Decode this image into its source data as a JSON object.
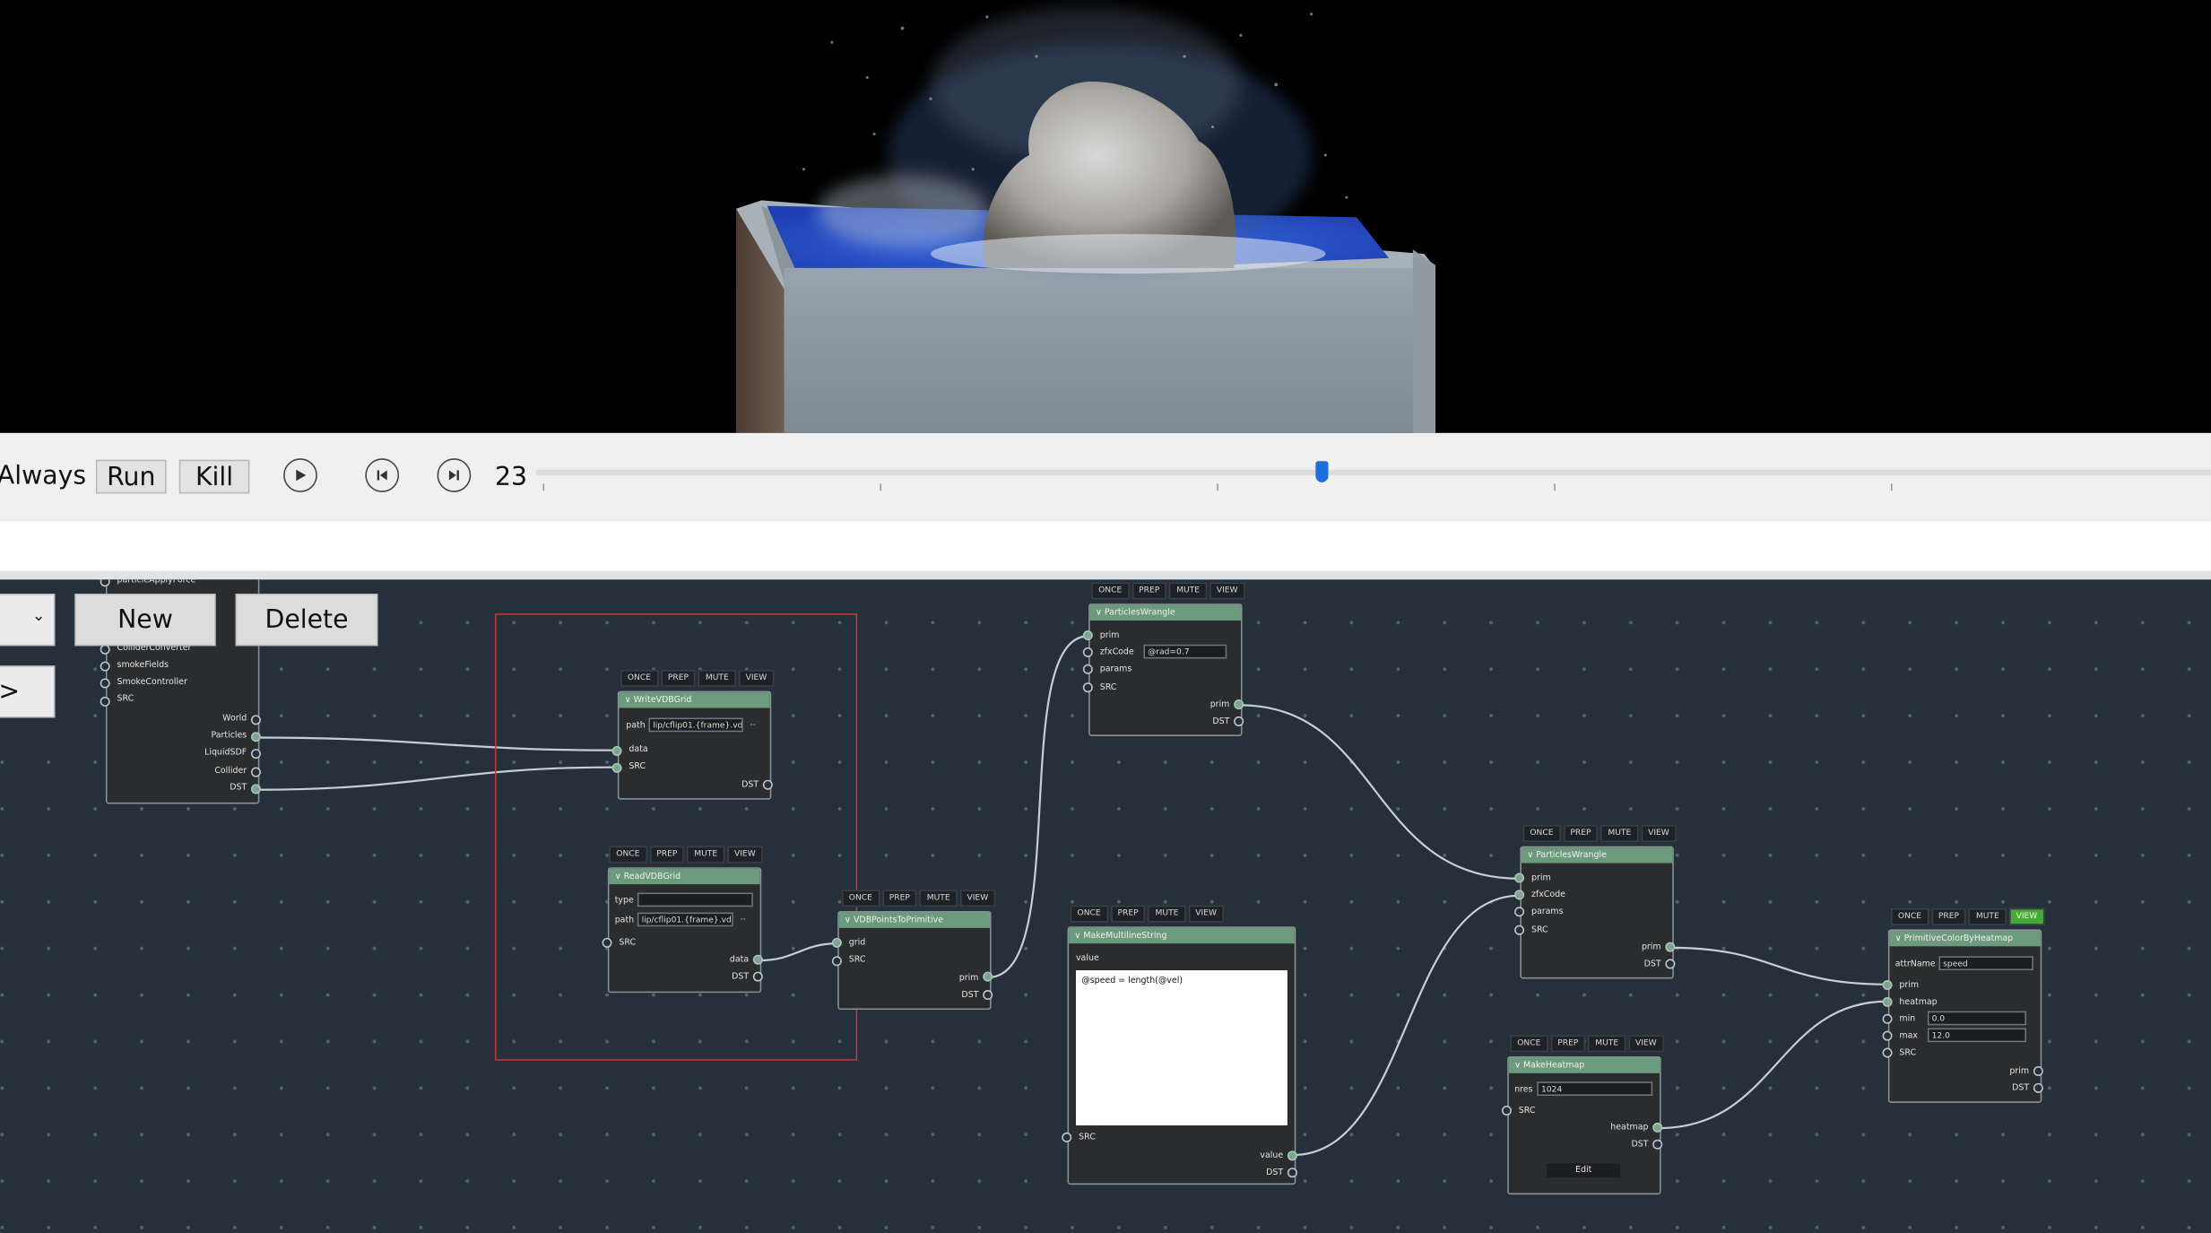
{
  "timeline": {
    "mode_label": "Always",
    "run_label": "Run",
    "kill_label": "Kill",
    "frame": "23",
    "slider_position": 0.48
  },
  "editor_buttons": {
    "new_label": "New",
    "delete_label": "Delete",
    "arrow_label": ">"
  },
  "node_buttons": {
    "once": "ONCE",
    "prep": "PREP",
    "mute": "MUTE",
    "view": "VIEW"
  },
  "nodes": {
    "partial": {
      "top_label": "particleApplyForce",
      "inputs": [
        "ColliderConverter",
        "smokeFields",
        "SmokeController",
        "SRC"
      ],
      "outputs": [
        "World",
        "Particles",
        "LiquidSDF",
        "Collider",
        "DST"
      ]
    },
    "write_vdb": {
      "title": "WriteVDBGrid",
      "path_label": "path",
      "path_value": "lip/cflip01.{frame}.vdb",
      "dots": "..",
      "in_data": "data",
      "in_src": "SRC",
      "out_dst": "DST"
    },
    "read_vdb": {
      "title": "ReadVDBGrid",
      "type_label": "type",
      "type_value": "",
      "path_label": "path",
      "path_value": "lip/cflip01.{frame}.vdb",
      "dots": "..",
      "in_src": "SRC",
      "out_data": "data",
      "out_dst": "DST"
    },
    "vdb_points": {
      "title": "VDBPointsToPrimitive",
      "in_grid": "grid",
      "in_src": "SRC",
      "out_prim": "prim",
      "out_dst": "DST"
    },
    "wrangle1": {
      "title": "ParticlesWrangle",
      "in_prim": "prim",
      "zfx_label": "zfxCode",
      "zfx_value": "@rad=0.7",
      "in_params": "params",
      "in_src": "SRC",
      "out_prim": "prim",
      "out_dst": "DST"
    },
    "multiline": {
      "title": "MakeMultilineString",
      "value_label": "value",
      "text": "@speed = length(@vel)",
      "in_src": "SRC",
      "out_value": "value",
      "out_dst": "DST"
    },
    "wrangle2": {
      "title": "ParticlesWrangle",
      "in_prim": "prim",
      "in_zfx": "zfxCode",
      "in_params": "params",
      "in_src": "SRC",
      "out_prim": "prim",
      "out_dst": "DST"
    },
    "heatmap": {
      "title": "MakeHeatmap",
      "nres_label": "nres",
      "nres_value": "1024",
      "in_src": "SRC",
      "out_heatmap": "heatmap",
      "out_dst": "DST",
      "edit_label": "Edit"
    },
    "color_heatmap": {
      "title": "PrimitiveColorByHeatmap",
      "attr_label": "attrName",
      "attr_value": "speed",
      "in_prim": "prim",
      "in_heatmap": "heatmap",
      "min_label": "min",
      "min_value": "0.0",
      "max_label": "max",
      "max_value": "12.0",
      "in_src": "SRC",
      "out_prim": "prim",
      "out_dst": "DST"
    }
  }
}
